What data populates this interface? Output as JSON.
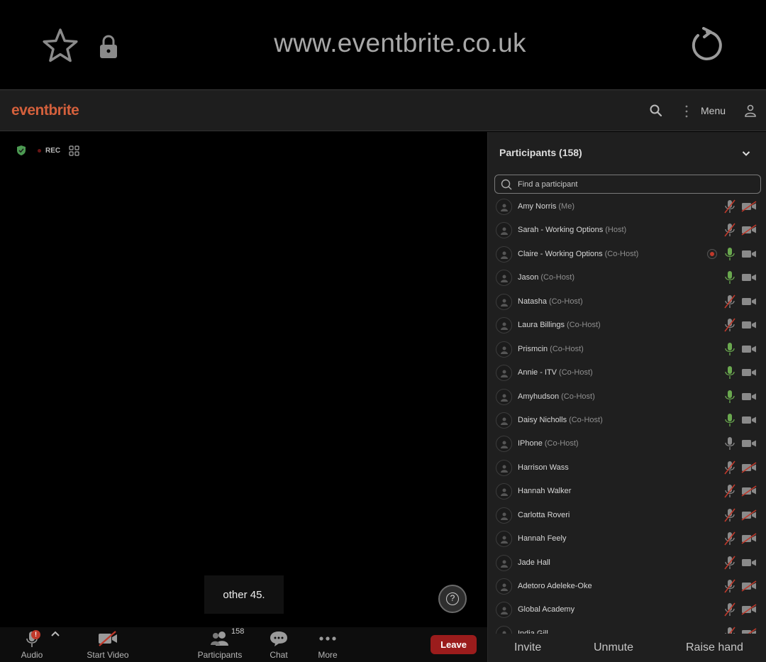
{
  "browser": {
    "url": "www.eventbrite.co.uk",
    "icons": [
      "star-icon",
      "lock-icon",
      "reload-icon"
    ]
  },
  "header": {
    "logo": "eventbrite",
    "menu_label": "Menu",
    "brand_color": "#d4603c"
  },
  "video": {
    "rec_label": "REC",
    "caption": "other 45."
  },
  "toolbar": {
    "audio_label": "Audio",
    "audio_badge": "!",
    "start_video_label": "Start Video",
    "participants_label": "Participants",
    "participants_count": "158",
    "chat_label": "Chat",
    "more_label": "More",
    "leave_label": "Leave"
  },
  "panel": {
    "title": "Participants (158)",
    "search_placeholder": "Find a participant",
    "participants": [
      {
        "name": "Amy Norris",
        "role": "(Me)",
        "mic": "muted",
        "cam": "off"
      },
      {
        "name": "Sarah - Working Options",
        "role": "(Host)",
        "mic": "muted",
        "cam": "off"
      },
      {
        "name": "Claire - Working Options",
        "role": "(Co-Host)",
        "mic": "on",
        "cam": "on",
        "recording": true
      },
      {
        "name": "Jason",
        "role": "(Co-Host)",
        "mic": "on",
        "cam": "on"
      },
      {
        "name": "Natasha",
        "role": "(Co-Host)",
        "mic": "muted",
        "cam": "on"
      },
      {
        "name": "Laura Billings",
        "role": "(Co-Host)",
        "mic": "muted",
        "cam": "on"
      },
      {
        "name": "Prismcin",
        "role": "(Co-Host)",
        "mic": "on",
        "cam": "on"
      },
      {
        "name": "Annie - ITV",
        "role": "(Co-Host)",
        "mic": "on",
        "cam": "on"
      },
      {
        "name": "Amyhudson",
        "role": "(Co-Host)",
        "mic": "on",
        "cam": "on"
      },
      {
        "name": "Daisy Nicholls",
        "role": "(Co-Host)",
        "mic": "on",
        "cam": "on"
      },
      {
        "name": "IPhone",
        "role": "(Co-Host)",
        "mic": "idle",
        "cam": "on"
      },
      {
        "name": "Harrison Wass",
        "role": "",
        "mic": "muted",
        "cam": "off"
      },
      {
        "name": "Hannah Walker",
        "role": "",
        "mic": "muted",
        "cam": "off"
      },
      {
        "name": "Carlotta Roveri",
        "role": "",
        "mic": "muted",
        "cam": "off"
      },
      {
        "name": "Hannah Feely",
        "role": "",
        "mic": "muted",
        "cam": "off"
      },
      {
        "name": "Jade Hall",
        "role": "",
        "mic": "muted",
        "cam": "on"
      },
      {
        "name": "Adetoro Adeleke-Oke",
        "role": "",
        "mic": "muted",
        "cam": "off"
      },
      {
        "name": "Global Academy",
        "role": "",
        "mic": "muted",
        "cam": "off"
      },
      {
        "name": "India Gill",
        "role": "",
        "mic": "muted",
        "cam": "off"
      }
    ],
    "footer": {
      "invite_label": "Invite",
      "unmute_label": "Unmute",
      "raise_hand_label": "Raise hand"
    }
  },
  "colors": {
    "mic_on": "#6aa84f",
    "mic_idle": "#8a8a8a",
    "muted_slash": "#c0392b",
    "leave": "#9b1c1c"
  }
}
